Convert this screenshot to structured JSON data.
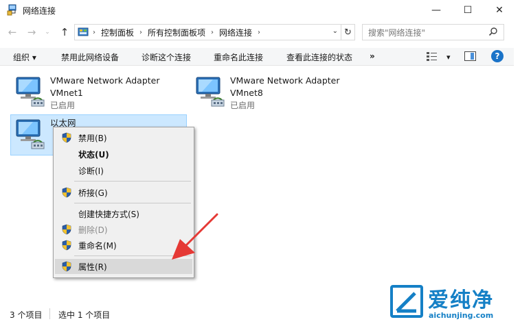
{
  "window": {
    "title": "网络连接",
    "min_glyph": "—",
    "max_glyph": "☐",
    "close_glyph": "✕"
  },
  "nav": {
    "back_glyph": "←",
    "forward_glyph": "→",
    "recent_glyph": "⌄",
    "up_glyph": "↑",
    "refresh_glyph": "↻",
    "crumb_sep": "›",
    "dropdown_glyph": "⌄"
  },
  "breadcrumb": [
    "控制面板",
    "所有控制面板项",
    "网络连接"
  ],
  "search": {
    "placeholder": "搜索\"网络连接\""
  },
  "toolbar": {
    "organize": "组织 ▾",
    "disable": "禁用此网络设备",
    "diagnose": "诊断这个连接",
    "rename": "重命名此连接",
    "view_status": "查看此连接的状态",
    "more": "»",
    "view_dropdown": "▾",
    "help": "?"
  },
  "adapters": [
    {
      "name": "VMware Network Adapter",
      "sub": "VMnet1",
      "status": "已启用"
    },
    {
      "name": "VMware Network Adapter",
      "sub": "VMnet8",
      "status": "已启用"
    },
    {
      "name": "以太网",
      "sub": "",
      "status": ""
    }
  ],
  "context_menu": {
    "items": [
      {
        "label": "禁用(B)",
        "shield": true
      },
      {
        "label": "状态(U)",
        "bold": true
      },
      {
        "label": "诊断(I)"
      },
      {
        "label": "桥接(G)",
        "shield": true
      },
      {
        "label": "创建快捷方式(S)"
      },
      {
        "label": "删除(D)",
        "shield": true,
        "disabled": true
      },
      {
        "label": "重命名(M)",
        "shield": true
      },
      {
        "label": "属性(R)",
        "shield": true,
        "highlighted": true
      }
    ]
  },
  "statusbar": {
    "count": "3 个项目",
    "selected": "选中 1 个项目"
  },
  "watermark": {
    "brand": "爱纯净",
    "url": "aichunjing.com"
  },
  "colors": {
    "selection_bg": "#cce8ff",
    "accent_blue": "#1580c6",
    "arrow_red": "#e53935"
  }
}
